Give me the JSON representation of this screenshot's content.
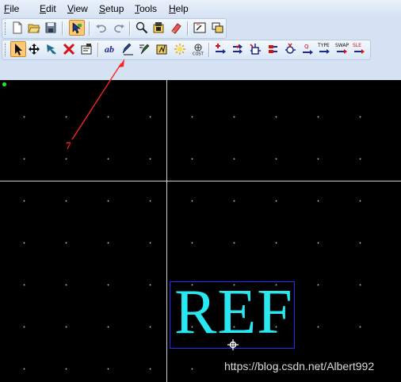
{
  "menu": {
    "file": {
      "ul": "F",
      "rest": "ile"
    },
    "edit": {
      "ul": "E",
      "rest": "dit"
    },
    "view": {
      "ul": "V",
      "rest": "iew"
    },
    "setup": {
      "ul": "S",
      "rest": "etup"
    },
    "tools": {
      "ul": "T",
      "rest": "ools"
    },
    "help": {
      "ul": "H",
      "rest": "elp"
    }
  },
  "toolbar_top": [
    "new-file",
    "open-folder",
    "save",
    "select-pointer",
    "undo",
    "redo",
    "zoom",
    "library",
    "erase",
    "report",
    "window"
  ],
  "toolbar_design": [
    "select",
    "move",
    "move-drag",
    "delete",
    "properties",
    "text",
    "edit-text",
    "edit-attribute",
    "edit-pad",
    "highlight",
    "cost",
    "add-net",
    "add-route",
    "add-pin",
    "add-pad",
    "add-via",
    "renumber-type",
    "type",
    "swap",
    "sle"
  ],
  "toolbar_labels": {
    "type": "TYPE",
    "swap": "SWAP",
    "sle": "SLE"
  },
  "canvas": {
    "reference_text": "REF",
    "background_color": "#000000",
    "text_color": "#27e8f0",
    "box_color": "#2a2aff"
  },
  "annotation": {
    "label": "7",
    "color": "#ff2020"
  },
  "watermark": "https://blog.csdn.net/Albert992"
}
